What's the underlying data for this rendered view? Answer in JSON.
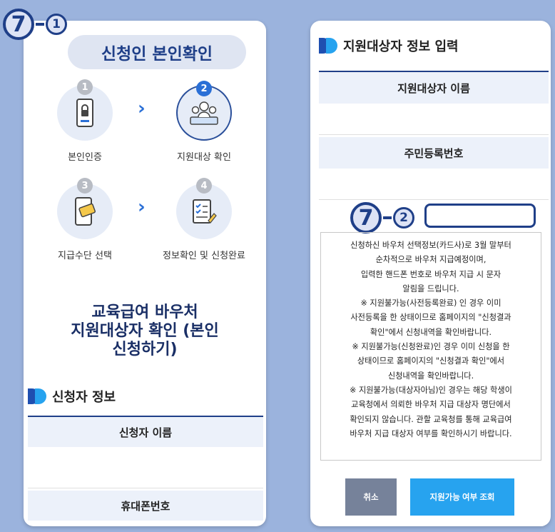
{
  "header": {
    "title": "신청인 본인확인",
    "left_badge_main": "7",
    "left_badge_sub": "1",
    "right_badge_main": "7",
    "right_badge_sub": "2"
  },
  "steps": [
    {
      "num": "1",
      "label": "본인인증",
      "icon": "phone-lock-icon",
      "active": false
    },
    {
      "num": "2",
      "label": "지원대상 확인",
      "icon": "people-icon",
      "active": true
    },
    {
      "num": "3",
      "label": "지급수단 선택",
      "icon": "card-icon",
      "active": false
    },
    {
      "num": "4",
      "label": "정보확인 및 신청완료",
      "icon": "checklist-icon",
      "active": false
    }
  ],
  "main_heading": {
    "line1": "교육급여 바우처",
    "line2": "지원대상자 확인 (본인",
    "line3": "신청하기)"
  },
  "applicant": {
    "section_title": "신청자 정보",
    "name_label": "신청자 이름",
    "phone_label": "휴대폰번호"
  },
  "target": {
    "section_title": "지원대상자 정보 입력",
    "name_label": "지원대상자 이름",
    "rrn_label": "주민등록번호"
  },
  "notice": [
    "신청하신 바우처 선택정보(카드사)로 3월 말부터",
    "순차적으로 바우처 지급예정이며,",
    "입력한 핸드폰 번호로 바우처 지급 시 문자",
    "알림을 드립니다.",
    "※ 지원불가능(사전등록완료) 인 경우 이미",
    "사전등록을 한 상태이므로 홈페이지의 \"신청결과",
    "확인\"에서 신청내역을 확인바랍니다.",
    "※ 지원불가능(신청완료)인 경우 이미 신청을 한",
    "상태이므로 홈페이지의 \"신청결과 확인\"에서",
    "신청내역을 확인바랍니다.",
    "※ 지원불가능(대상자아님)인 경우는 해당 학생이",
    "교육청에서 의뢰한 바우처 지급 대상자 명단에서",
    "확인되지 않습니다. 관할 교육청를 통해 교육급여",
    "바우처 지급 대상자 여부를 확인하시기 바랍니다."
  ],
  "buttons": {
    "cancel": "취소",
    "check": "지원가능 여부 조회"
  },
  "colors": {
    "background": "#9bb3dd",
    "navy": "#1f3f88",
    "accent_blue": "#27a3ef",
    "cancel_gray": "#76829a"
  }
}
